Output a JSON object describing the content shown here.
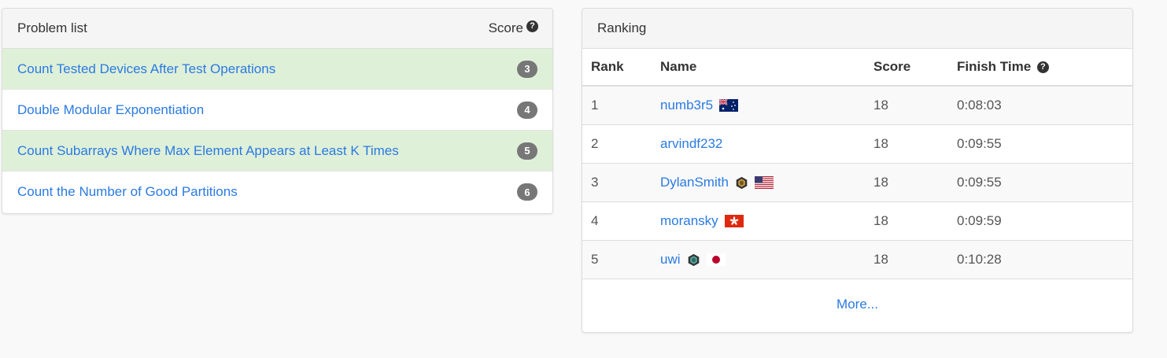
{
  "problems": {
    "heading": "Problem list",
    "score_label": "Score",
    "help_icon": "question-circle-icon",
    "items": [
      {
        "title": "Count Tested Devices After Test Operations",
        "score": "3",
        "solved": true
      },
      {
        "title": "Double Modular Exponentiation",
        "score": "4",
        "solved": false
      },
      {
        "title": "Count Subarrays Where Max Element Appears at Least K Times",
        "score": "5",
        "solved": true
      },
      {
        "title": "Count the Number of Good Partitions",
        "score": "6",
        "solved": false
      }
    ]
  },
  "ranking": {
    "heading": "Ranking",
    "columns": {
      "rank": "Rank",
      "name": "Name",
      "score": "Score",
      "finish_time": "Finish Time"
    },
    "rows": [
      {
        "rank": "1",
        "name": "numb3r5",
        "score": "18",
        "time": "0:08:03",
        "flag": "australia-flag-icon"
      },
      {
        "rank": "2",
        "name": "arvindf232",
        "score": "18",
        "time": "0:09:55"
      },
      {
        "rank": "3",
        "name": "DylanSmith",
        "score": "18",
        "time": "0:09:55",
        "badge": "guardian-hex-icon",
        "flag": "usa-flag-icon"
      },
      {
        "rank": "4",
        "name": "moransky",
        "score": "18",
        "time": "0:09:59",
        "flag": "hong-kong-flag-icon"
      },
      {
        "rank": "5",
        "name": "uwi",
        "score": "18",
        "time": "0:10:28",
        "badge": "knight-hex-icon",
        "flag": "japan-flag-icon"
      }
    ],
    "more_label": "More..."
  },
  "colors": {
    "link": "#2a7ae2",
    "solved_row": "#dff0d8",
    "badge": "#777777",
    "heading_bg": "#f5f5f5"
  }
}
